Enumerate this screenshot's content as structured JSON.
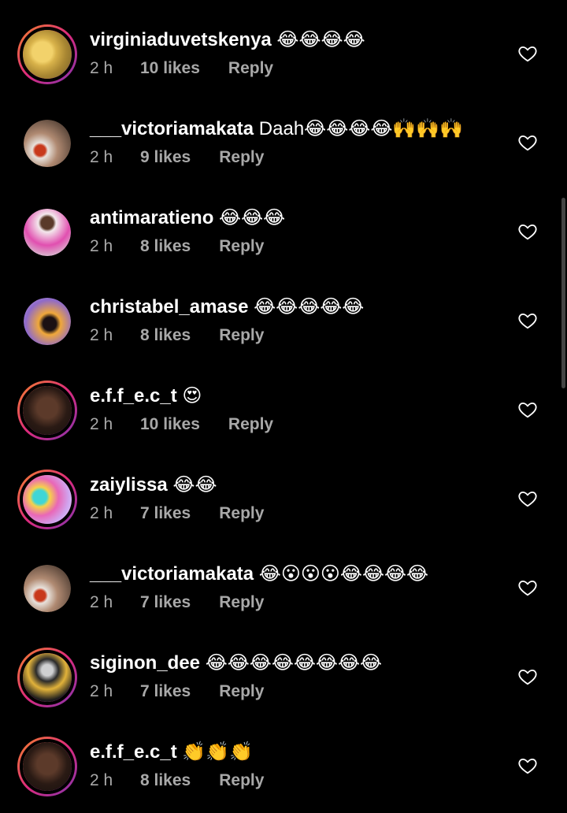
{
  "comments": [
    {
      "username": "virginiaduvetskenya",
      "text": " 😂😂😂😂",
      "time": "2 h",
      "likes": "10 likes",
      "reply": "Reply",
      "avatar": "bedding-photo",
      "story_ring": true
    },
    {
      "username": "___victoriamakata",
      "text": " Daah😂😂😂😂🙌🙌🙌",
      "time": "2 h",
      "likes": "9 likes",
      "reply": "Reply",
      "avatar": "person-with-rose",
      "story_ring": false
    },
    {
      "username": "antimaratieno",
      "text": " 😂😂😂",
      "time": "2 h",
      "likes": "8 likes",
      "reply": "Reply",
      "avatar": "person-in-pink",
      "story_ring": false
    },
    {
      "username": "christabel_amase",
      "text": " 😂😂😂😂😂",
      "time": "2 h",
      "likes": "8 likes",
      "reply": "Reply",
      "avatar": "person-with-headwrap",
      "story_ring": false
    },
    {
      "username": "e.f.f_e.c_t",
      "text": " 😍",
      "time": "2 h",
      "likes": "10 likes",
      "reply": "Reply",
      "avatar": "portrait-dark",
      "story_ring": true
    },
    {
      "username": "zaiylissa",
      "text": " 😂😂",
      "time": "2 h",
      "likes": "7 likes",
      "reply": "Reply",
      "avatar": "colorful-lovebirds",
      "story_ring": true
    },
    {
      "username": "___victoriamakata",
      "text": " 😂😮😮😮😂😂😂😂",
      "time": "2 h",
      "likes": "7 likes",
      "reply": "Reply",
      "avatar": "person-with-rose",
      "story_ring": false
    },
    {
      "username": "siginon_dee",
      "text": " 😂😂😂😂😂😂😂😂",
      "time": "2 h",
      "likes": "7 likes",
      "reply": "Reply",
      "avatar": "person-in-hat",
      "story_ring": true
    },
    {
      "username": "e.f.f_e.c_t",
      "text": " 👏👏👏",
      "time": "2 h",
      "likes": "8 likes",
      "reply": "Reply",
      "avatar": "portrait-dark",
      "story_ring": true
    }
  ],
  "icons": {
    "like": "heart-outline-icon"
  },
  "colors": {
    "background": "#000000",
    "primary_text": "#ffffff",
    "secondary_text": "#a8a8a8",
    "story_ring_start": "#f58529",
    "story_ring_end": "#8134af"
  }
}
